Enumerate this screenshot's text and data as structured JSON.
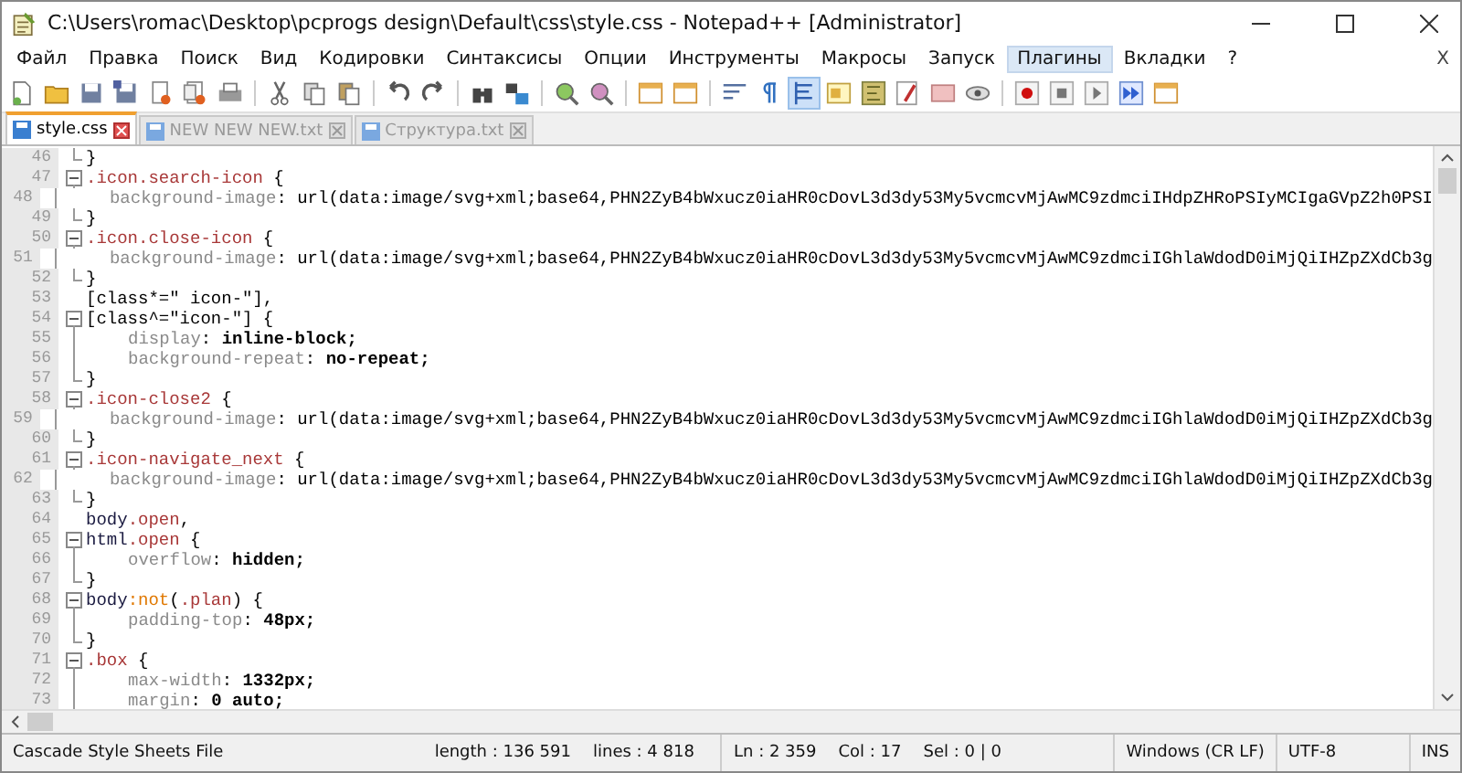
{
  "window": {
    "title": "C:\\Users\\romac\\Desktop\\pcprogs design\\Default\\css\\style.css - Notepad++ [Administrator]"
  },
  "menu": [
    {
      "label": "Файл",
      "selected": false
    },
    {
      "label": "Правка",
      "selected": false
    },
    {
      "label": "Поиск",
      "selected": false
    },
    {
      "label": "Вид",
      "selected": false
    },
    {
      "label": "Кодировки",
      "selected": false
    },
    {
      "label": "Синтаксисы",
      "selected": false
    },
    {
      "label": "Опции",
      "selected": false
    },
    {
      "label": "Инструменты",
      "selected": false
    },
    {
      "label": "Макросы",
      "selected": false
    },
    {
      "label": "Запуск",
      "selected": false
    },
    {
      "label": "Плагины",
      "selected": true
    },
    {
      "label": "Вкладки",
      "selected": false
    },
    {
      "label": "?",
      "selected": false
    }
  ],
  "menu_close": "X",
  "tabs": [
    {
      "label": "style.css",
      "selected": true
    },
    {
      "label": "NEW NEW NEW.txt",
      "selected": false
    },
    {
      "label": "Структура.txt",
      "selected": false
    }
  ],
  "editor": {
    "lines": [
      {
        "num": "46",
        "kind": "end",
        "indent": false,
        "tokens": [
          {
            "text": "}",
            "kind": "plain"
          }
        ]
      },
      {
        "num": "47",
        "kind": "open",
        "indent": false,
        "tokens": [
          {
            "text": ".icon.search-icon",
            "kind": "selector"
          },
          {
            "text": " {",
            "kind": "plain"
          }
        ]
      },
      {
        "num": "48",
        "kind": "mid",
        "indent": true,
        "tokens": [
          {
            "text": "background-image",
            "kind": "property"
          },
          {
            "text": ": ",
            "kind": "plain"
          },
          {
            "text": "url(data:image/svg+xml;base64,PHN2ZyB4bWxucz0iaHR0cDovL3d3dy53My5vcmcvMjAwMC9zdmciIHdpZHRoPSIyMCIgaGVpZ2h0PSI",
            "kind": "plain"
          }
        ]
      },
      {
        "num": "49",
        "kind": "end",
        "indent": false,
        "tokens": [
          {
            "text": "}",
            "kind": "plain"
          }
        ]
      },
      {
        "num": "50",
        "kind": "open",
        "indent": false,
        "tokens": [
          {
            "text": ".icon.close-icon",
            "kind": "selector"
          },
          {
            "text": " {",
            "kind": "plain"
          }
        ]
      },
      {
        "num": "51",
        "kind": "mid",
        "indent": true,
        "tokens": [
          {
            "text": "background-image",
            "kind": "property"
          },
          {
            "text": ": ",
            "kind": "plain"
          },
          {
            "text": "url(data:image/svg+xml;base64,PHN2ZyB4bWxucz0iaHR0cDovL3d3dy53My5vcmcvMjAwMC9zdmciIGhlaWdodD0iMjQiIHZpZXdCb3g",
            "kind": "plain"
          }
        ]
      },
      {
        "num": "52",
        "kind": "end",
        "indent": false,
        "tokens": [
          {
            "text": "}",
            "kind": "plain"
          }
        ]
      },
      {
        "num": "53",
        "kind": "none",
        "indent": false,
        "tokens": [
          {
            "text": "[class*=\" icon-\"],",
            "kind": "plain"
          }
        ]
      },
      {
        "num": "54",
        "kind": "open",
        "indent": false,
        "tokens": [
          {
            "text": "[class^=\"icon-\"] {",
            "kind": "plain"
          }
        ]
      },
      {
        "num": "55",
        "kind": "mid",
        "indent": true,
        "tokens": [
          {
            "text": "display",
            "kind": "property"
          },
          {
            "text": ": ",
            "kind": "plain"
          },
          {
            "text": "inline-block;",
            "kind": "value"
          }
        ]
      },
      {
        "num": "56",
        "kind": "mid",
        "indent": true,
        "tokens": [
          {
            "text": "background-repeat",
            "kind": "property"
          },
          {
            "text": ": ",
            "kind": "plain"
          },
          {
            "text": "no-repeat;",
            "kind": "value"
          }
        ]
      },
      {
        "num": "57",
        "kind": "end",
        "indent": false,
        "tokens": [
          {
            "text": "}",
            "kind": "plain"
          }
        ]
      },
      {
        "num": "58",
        "kind": "open",
        "indent": false,
        "tokens": [
          {
            "text": ".icon-close2",
            "kind": "selector"
          },
          {
            "text": " {",
            "kind": "plain"
          }
        ]
      },
      {
        "num": "59",
        "kind": "mid",
        "indent": true,
        "tokens": [
          {
            "text": "background-image",
            "kind": "property"
          },
          {
            "text": ": ",
            "kind": "plain"
          },
          {
            "text": "url(data:image/svg+xml;base64,PHN2ZyB4bWxucz0iaHR0cDovL3d3dy53My5vcmcvMjAwMC9zdmciIGhlaWdodD0iMjQiIHZpZXdCb3g",
            "kind": "plain"
          }
        ]
      },
      {
        "num": "60",
        "kind": "end",
        "indent": false,
        "tokens": [
          {
            "text": "}",
            "kind": "plain"
          }
        ]
      },
      {
        "num": "61",
        "kind": "open",
        "indent": false,
        "tokens": [
          {
            "text": ".icon-navigate_next",
            "kind": "selector"
          },
          {
            "text": " {",
            "kind": "plain"
          }
        ]
      },
      {
        "num": "62",
        "kind": "mid",
        "indent": true,
        "tokens": [
          {
            "text": "background-image",
            "kind": "property"
          },
          {
            "text": ": ",
            "kind": "plain"
          },
          {
            "text": "url(data:image/svg+xml;base64,PHN2ZyB4bWxucz0iaHR0cDovL3d3dy53My5vcmcvMjAwMC9zdmciIGhlaWdodD0iMjQiIHZpZXdCb3g",
            "kind": "plain"
          }
        ]
      },
      {
        "num": "63",
        "kind": "end",
        "indent": false,
        "tokens": [
          {
            "text": "}",
            "kind": "plain"
          }
        ]
      },
      {
        "num": "64",
        "kind": "none",
        "indent": false,
        "tokens": [
          {
            "text": "body",
            "kind": "tag"
          },
          {
            "text": ".open",
            "kind": "selector"
          },
          {
            "text": ",",
            "kind": "plain"
          }
        ]
      },
      {
        "num": "65",
        "kind": "open",
        "indent": false,
        "tokens": [
          {
            "text": "html",
            "kind": "tag"
          },
          {
            "text": ".open",
            "kind": "selector"
          },
          {
            "text": " {",
            "kind": "plain"
          }
        ]
      },
      {
        "num": "66",
        "kind": "mid",
        "indent": true,
        "tokens": [
          {
            "text": "overflow",
            "kind": "property"
          },
          {
            "text": ": ",
            "kind": "plain"
          },
          {
            "text": "hidden;",
            "kind": "value"
          }
        ]
      },
      {
        "num": "67",
        "kind": "end",
        "indent": false,
        "tokens": [
          {
            "text": "}",
            "kind": "plain"
          }
        ]
      },
      {
        "num": "68",
        "kind": "open",
        "indent": false,
        "tokens": [
          {
            "text": "body",
            "kind": "tag"
          },
          {
            "text": ":not",
            "kind": "pseudo"
          },
          {
            "text": "(",
            "kind": "plain"
          },
          {
            "text": ".plan",
            "kind": "selector"
          },
          {
            "text": ") {",
            "kind": "plain"
          }
        ]
      },
      {
        "num": "69",
        "kind": "mid",
        "indent": true,
        "tokens": [
          {
            "text": "padding-top",
            "kind": "property"
          },
          {
            "text": ": ",
            "kind": "plain"
          },
          {
            "text": "48px;",
            "kind": "value"
          }
        ]
      },
      {
        "num": "70",
        "kind": "end",
        "indent": false,
        "tokens": [
          {
            "text": "}",
            "kind": "plain"
          }
        ]
      },
      {
        "num": "71",
        "kind": "open",
        "indent": false,
        "tokens": [
          {
            "text": ".box",
            "kind": "selector"
          },
          {
            "text": " {",
            "kind": "plain"
          }
        ]
      },
      {
        "num": "72",
        "kind": "mid",
        "indent": true,
        "tokens": [
          {
            "text": "max-width",
            "kind": "property"
          },
          {
            "text": ": ",
            "kind": "plain"
          },
          {
            "text": "1332px;",
            "kind": "value"
          }
        ]
      },
      {
        "num": "73",
        "kind": "mid",
        "indent": true,
        "tokens": [
          {
            "text": "margin",
            "kind": "property"
          },
          {
            "text": ": ",
            "kind": "plain"
          },
          {
            "text": "0 auto;",
            "kind": "value"
          }
        ]
      }
    ]
  },
  "status_bar": {
    "file_type": "Cascade Style Sheets File",
    "length": "length : 136 591",
    "lines": "lines : 4 818",
    "ln": "Ln : 2 359",
    "col": "Col : 17",
    "sel": "Sel : 0 | 0",
    "eol": "Windows (CR LF)",
    "encoding": "UTF-8",
    "mode": "INS"
  }
}
